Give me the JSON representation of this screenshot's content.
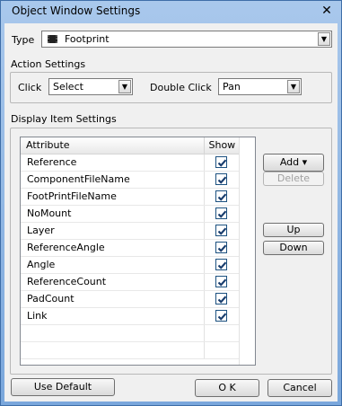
{
  "window": {
    "title": "Object Window Settings",
    "close": "✕"
  },
  "type": {
    "label": "Type",
    "value": "Footprint",
    "icon": "chip-icon"
  },
  "action_settings": {
    "header": "Action Settings",
    "click_label": "Click",
    "click_value": "Select",
    "double_click_label": "Double Click",
    "double_click_value": "Pan"
  },
  "display": {
    "header": "Display Item Settings",
    "columns": [
      "Attribute",
      "Show"
    ],
    "rows": [
      {
        "attribute": "Reference",
        "show": true
      },
      {
        "attribute": "ComponentFileName",
        "show": true
      },
      {
        "attribute": "FootPrintFileName",
        "show": true
      },
      {
        "attribute": "NoMount",
        "show": true
      },
      {
        "attribute": "Layer",
        "show": true
      },
      {
        "attribute": "ReferenceAngle",
        "show": true
      },
      {
        "attribute": "Angle",
        "show": true
      },
      {
        "attribute": "ReferenceCount",
        "show": true
      },
      {
        "attribute": "PadCount",
        "show": true
      },
      {
        "attribute": "Link",
        "show": true
      }
    ],
    "add_label": "Add ▾",
    "delete_label": "Delete",
    "up_label": "Up",
    "down_label": "Down"
  },
  "footer": {
    "use_default": "Use Default",
    "ok": "O K",
    "cancel": "Cancel"
  }
}
